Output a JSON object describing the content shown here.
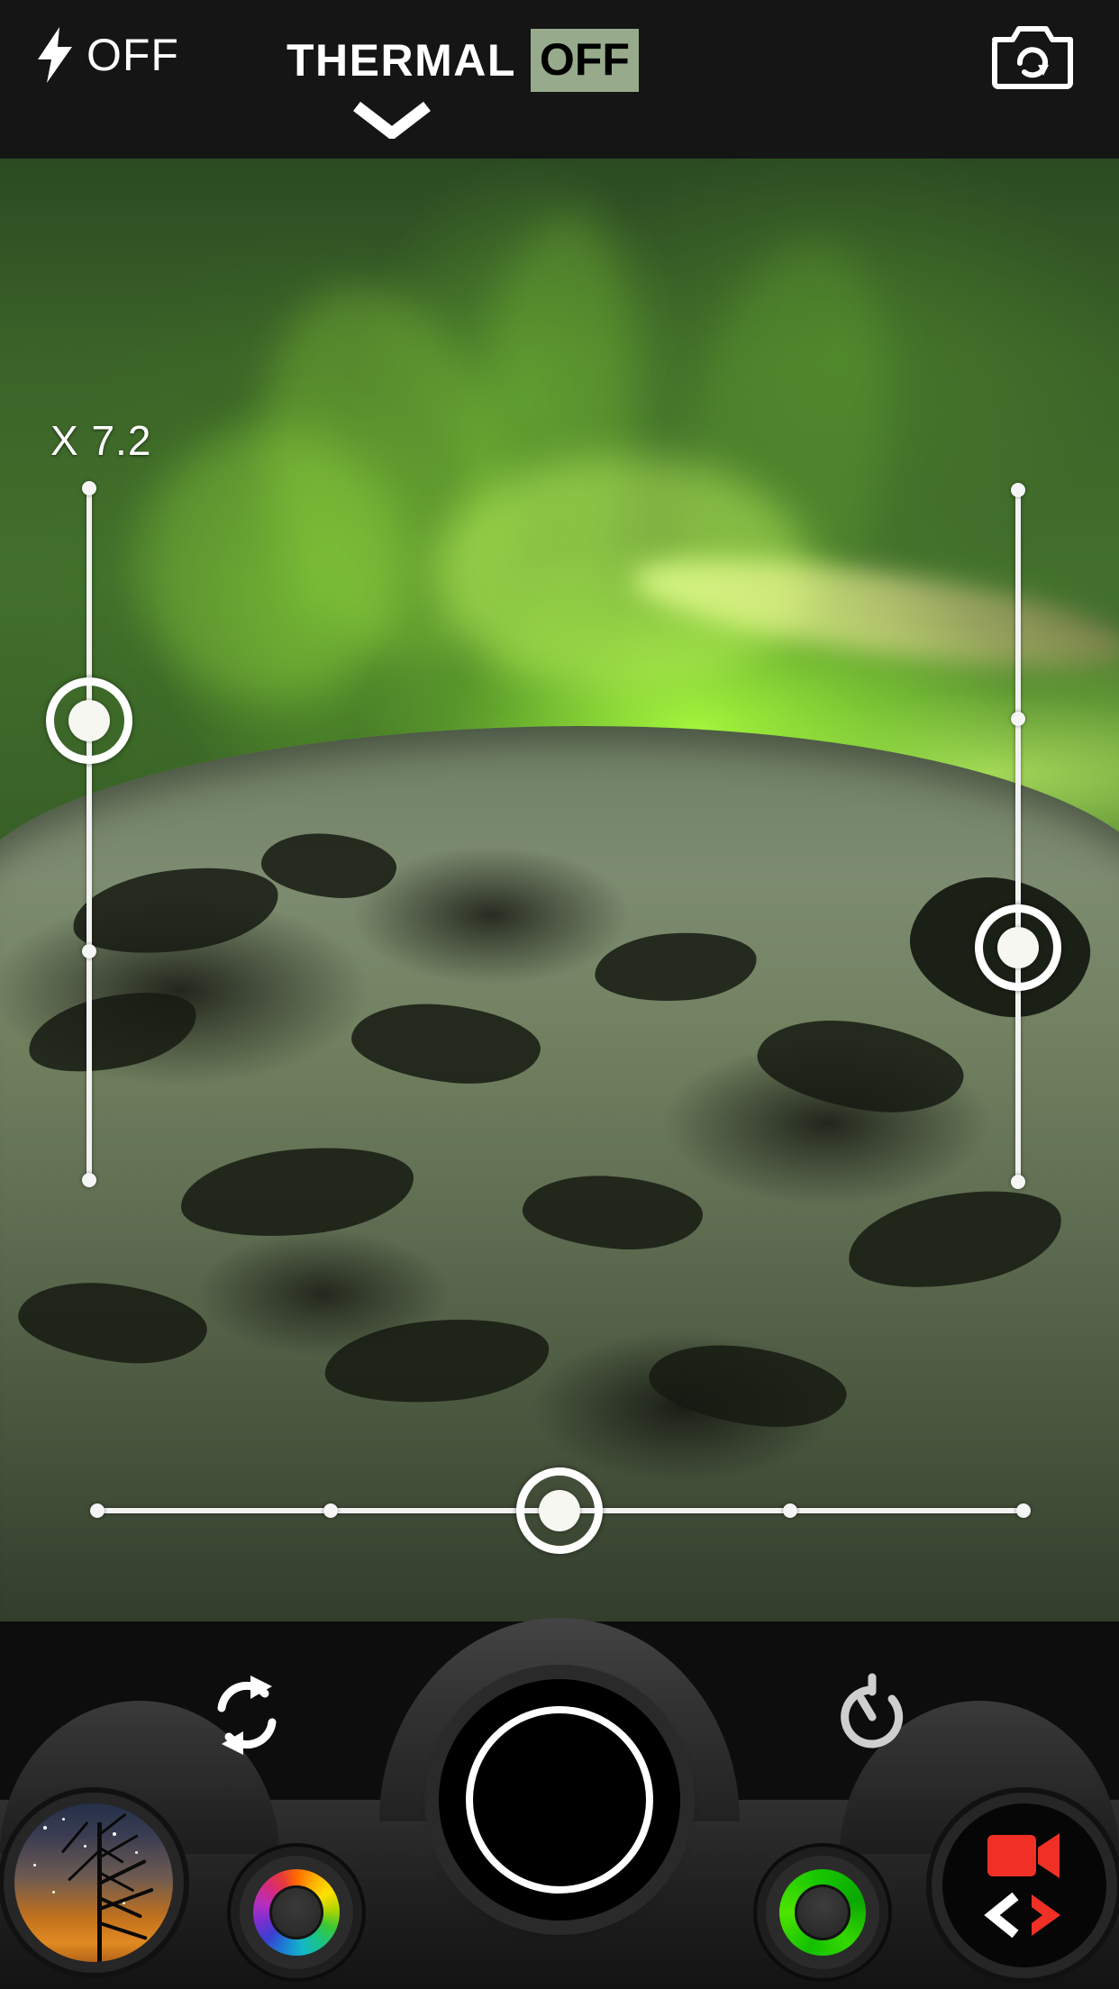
{
  "app": {
    "name": "Camera",
    "screen": "viewfinder"
  },
  "topbar": {
    "flash": {
      "icon": "flash-bolt-icon",
      "label": "OFF",
      "state": "off"
    },
    "thermal": {
      "label": "THERMAL",
      "state": "OFF",
      "badge_bg": "#97ab8c",
      "badge_fg": "#000000",
      "expand_icon": "chevron-down-icon"
    },
    "camera_switch": {
      "icon": "camera-rotate-icon"
    },
    "background": "#151515"
  },
  "viewfinder": {
    "scene": "aurora-borealis-over-snowy-ridge",
    "zoom": {
      "label": "X 7.2",
      "value": 7.2,
      "prefix": "X"
    },
    "sliders": [
      {
        "name": "zoom-slider",
        "orientation": "vertical",
        "value_position_pct": 33,
        "ticks": 3,
        "track_color": "#f2f2f2",
        "knob_color": "#ffffff"
      },
      {
        "name": "exposure-slider",
        "orientation": "vertical",
        "value_position_pct": 66,
        "ticks": 3,
        "track_color": "#f2f2f2",
        "knob_color": "#ffffff"
      },
      {
        "name": "focus-slider",
        "orientation": "horizontal",
        "value_position_pct": 50,
        "ticks": 4,
        "track_color": "#f2f2f2",
        "knob_color": "#ffffff"
      }
    ]
  },
  "bottombar": {
    "gallery": {
      "name": "gallery-thumbnail",
      "preview": "starry-night-tree-photo"
    },
    "color_wheel": {
      "name": "white-balance-button",
      "icon": "color-wheel-icon"
    },
    "shutter": {
      "name": "shutter-button",
      "icon": "shutter-ring-icon"
    },
    "green_ring": {
      "name": "iso-button",
      "icon": "green-ring-icon",
      "accent": "#18c800"
    },
    "video_mode": {
      "name": "video-mode-button",
      "icon": "camcorder-icon",
      "accent": "#f03025",
      "nav_prev_icon": "chevron-left-icon",
      "nav_next_icon": "chevron-right-icon"
    },
    "rotate": {
      "name": "orientation-lock-button",
      "icon": "rotate-refresh-icon"
    },
    "timer": {
      "name": "self-timer-button",
      "icon": "timer-icon"
    }
  },
  "colors": {
    "bar_bg": "#151515",
    "deck_bg": "#242424",
    "accent_red": "#f03025",
    "accent_green": "#18c800",
    "thermal_badge": "#97ab8c",
    "slider_white": "#ffffff"
  }
}
